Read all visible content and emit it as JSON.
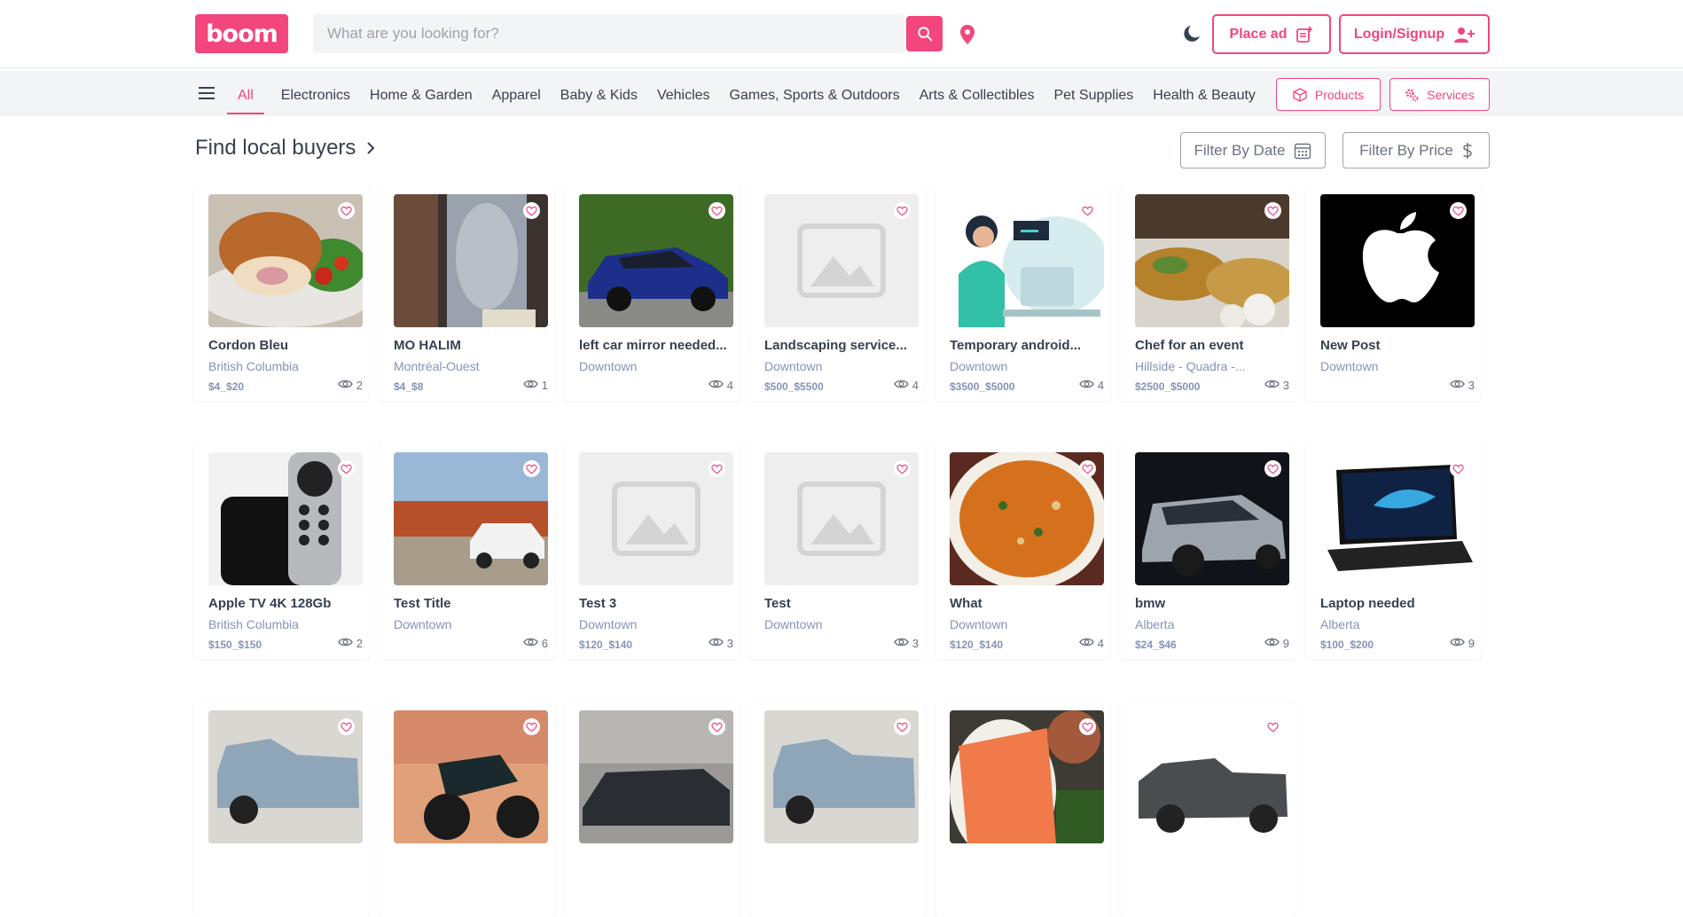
{
  "header": {
    "logo_text": "boom",
    "search_placeholder": "What are you looking for?",
    "place_ad_label": "Place ad",
    "login_label": "Login/Signup"
  },
  "categories": [
    "All",
    "Electronics",
    "Home & Garden",
    "Apparel",
    "Baby & Kids",
    "Vehicles",
    "Games, Sports & Outdoors",
    "Arts & Collectibles",
    "Pet Supplies",
    "Health & Beauty"
  ],
  "toggles": {
    "products_label": "Products",
    "services_label": "Services"
  },
  "section": {
    "title": "Find local buyers"
  },
  "filters": {
    "date_label": "Filter By Date",
    "price_label": "Filter By Price"
  },
  "listings": [
    {
      "title": "Cordon Bleu",
      "location": "British Columbia",
      "price": "$4_$20",
      "views": "2",
      "image": "food-cordon-bleu"
    },
    {
      "title": "MO HALIM",
      "location": "Montréal-Ouest",
      "price": "$4_$8",
      "views": "1",
      "image": "clothing-mannequin"
    },
    {
      "title": "left car mirror needed...",
      "location": "Downtown",
      "price": "",
      "views": "4",
      "image": "blue-car"
    },
    {
      "title": "Landscaping service...",
      "location": "Downtown",
      "price": "$500_$5500",
      "views": "4",
      "image": "placeholder"
    },
    {
      "title": "Temporary android...",
      "location": "Downtown",
      "price": "$3500_$5000",
      "views": "4",
      "image": "developer-illustration"
    },
    {
      "title": "Chef for an event",
      "location": "Hillside - Quadra -...",
      "price": "$2500_$5000",
      "views": "3",
      "image": "buffet"
    },
    {
      "title": "New Post",
      "location": "Downtown",
      "price": "",
      "views": "3",
      "image": "apple-logo"
    },
    {
      "title": "Apple TV 4K 128Gb",
      "location": "British Columbia",
      "price": "$150_$150",
      "views": "2",
      "image": "apple-tv"
    },
    {
      "title": "Test Title",
      "location": "Downtown",
      "price": "",
      "views": "6",
      "image": "white-suv-desert"
    },
    {
      "title": "Test 3",
      "location": "Downtown",
      "price": "$120_$140",
      "views": "3",
      "image": "placeholder"
    },
    {
      "title": "Test",
      "location": "Downtown",
      "price": "",
      "views": "3",
      "image": "placeholder"
    },
    {
      "title": "What",
      "location": "Downtown",
      "price": "$120_$140",
      "views": "4",
      "image": "soup"
    },
    {
      "title": "bmw",
      "location": "Alberta",
      "price": "$24_$46",
      "views": "9",
      "image": "silver-suv"
    },
    {
      "title": "Laptop needed",
      "location": "Alberta",
      "price": "$100_$200",
      "views": "9",
      "image": "laptop"
    },
    {
      "title": "",
      "location": "",
      "price": "",
      "views": "",
      "image": "pickup-truck"
    },
    {
      "title": "",
      "location": "",
      "price": "",
      "views": "",
      "image": "motorcycle"
    },
    {
      "title": "",
      "location": "",
      "price": "",
      "views": "",
      "image": "dark-sedan"
    },
    {
      "title": "",
      "location": "",
      "price": "",
      "views": "",
      "image": "pickup-truck"
    },
    {
      "title": "",
      "location": "",
      "price": "",
      "views": "",
      "image": "salmon"
    },
    {
      "title": "",
      "location": "",
      "price": "",
      "views": "",
      "image": "grey-pickup"
    }
  ],
  "colors": {
    "brand": "#f2467d",
    "muted_text": "#8593b8"
  }
}
